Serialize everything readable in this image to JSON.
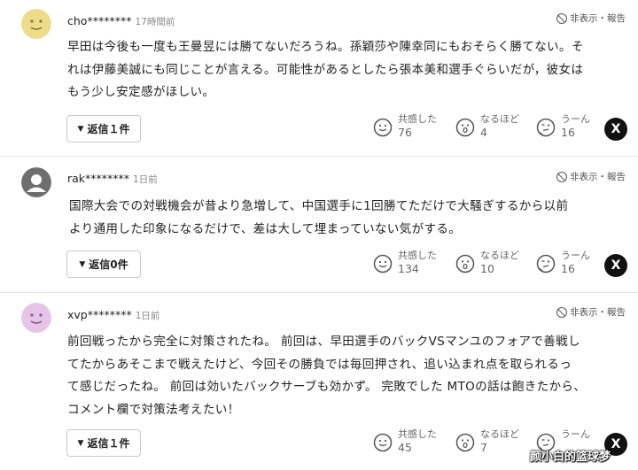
{
  "ui": {
    "hide_report": "非表示・報告",
    "x_label": "X",
    "reactions": {
      "empathy": "共感した",
      "indeed": "なるほど",
      "hmm": "うーん"
    }
  },
  "comments": [
    {
      "user": "cho********",
      "time": "17時間前",
      "avatar_color": "#eddc8a",
      "lines": [
        "早田は今後も一度も王曼昱には勝てないだろうね。孫穎莎や陳幸同にもおそらく勝てない。そ",
        "れは伊藤美誠にも同じことが言える。可能性があるとしたら張本美和選手ぐらいだが，彼女は",
        "もう少し安定感がほしい。"
      ],
      "reply": "返信１件",
      "counts": {
        "empathy": "76",
        "indeed": "4",
        "hmm": "16"
      }
    },
    {
      "user": "rak********",
      "time": "1日前",
      "avatar_color": "#6e6e6e",
      "lines": [
        "国際大会での対戦機会が昔より急増して、中国選手に1回勝てただけで大騒ぎするから以前",
        "より通用した印象になるだけで、差は大して埋まっていない気がする。"
      ],
      "reply": "返信0件",
      "counts": {
        "empathy": "134",
        "indeed": "10",
        "hmm": "16"
      }
    },
    {
      "user": "xvp********",
      "time": "1日前",
      "avatar_color": "#e6c4e8",
      "lines": [
        "前回戦ったから完全に対策されたね。 前回は、早田選手のバックVSマンユのフォアで善戦し",
        "てたからあそこまで戦えたけど、今回その勝負では毎回押され、追い込まれ点を取られるっ",
        "て感じだったね。 前回は効いたバックサーブも効かず。 完敗でした MTOの話は飽きたから、",
        "コメント欄で対策法考えたい！"
      ],
      "reply": "返信１件",
      "counts": {
        "empathy": "45",
        "indeed": "7",
        "hmm": ""
      }
    }
  ],
  "watermark": "颜小白的篮球梦"
}
